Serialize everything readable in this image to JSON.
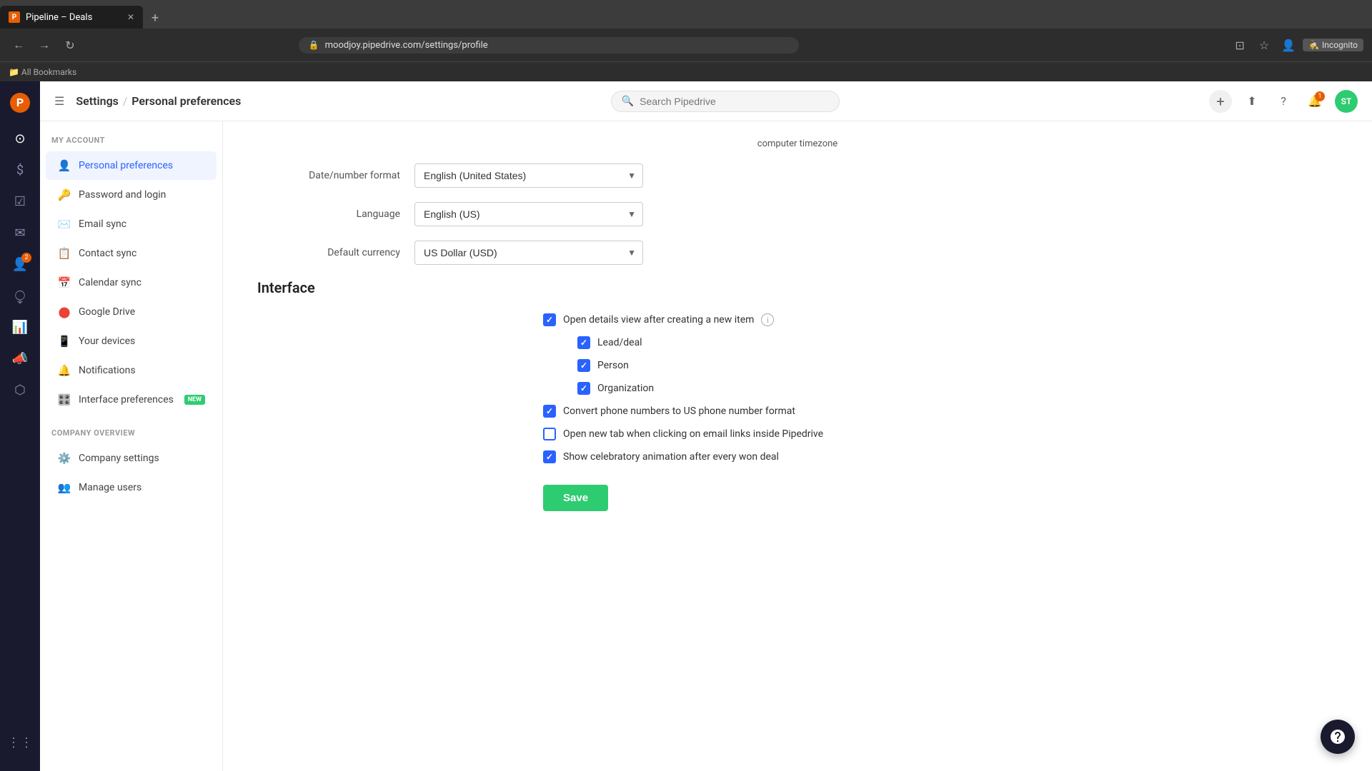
{
  "browser": {
    "tab_title": "Pipeline – Deals",
    "tab_icon": "P",
    "address": "moodjoy.pipedrive.com/settings/profile",
    "new_tab_label": "+",
    "incognito_label": "Incognito",
    "bookmarks_label": "All Bookmarks"
  },
  "header": {
    "settings_label": "Settings",
    "sep": "/",
    "page_title": "Personal preferences",
    "search_placeholder": "Search Pipedrive",
    "avatar_initials": "ST",
    "notification_count": "1"
  },
  "sidebar": {
    "my_account_label": "MY ACCOUNT",
    "company_overview_label": "COMPANY OVERVIEW",
    "items": [
      {
        "id": "personal-preferences",
        "label": "Personal preferences",
        "icon": "👤",
        "active": true
      },
      {
        "id": "password-and-login",
        "label": "Password and login",
        "icon": "🔑",
        "active": false
      },
      {
        "id": "email-sync",
        "label": "Email sync",
        "icon": "✉️",
        "active": false
      },
      {
        "id": "contact-sync",
        "label": "Contact sync",
        "icon": "📋",
        "active": false
      },
      {
        "id": "calendar-sync",
        "label": "Calendar sync",
        "icon": "📅",
        "active": false
      },
      {
        "id": "google-drive",
        "label": "Google Drive",
        "icon": "🔴",
        "active": false
      },
      {
        "id": "your-devices",
        "label": "Your devices",
        "icon": "📱",
        "active": false
      },
      {
        "id": "notifications",
        "label": "Notifications",
        "icon": "🔔",
        "active": false
      },
      {
        "id": "interface-preferences",
        "label": "Interface preferences",
        "icon": "🎛️",
        "active": false,
        "badge": "NEW"
      }
    ],
    "company_items": [
      {
        "id": "company-settings",
        "label": "Company settings",
        "icon": "⚙️",
        "active": false
      },
      {
        "id": "manage-users",
        "label": "Manage users",
        "icon": "👥",
        "active": false
      }
    ]
  },
  "content": {
    "timezone_note": "computer timezone",
    "date_format_label": "Date/number format",
    "date_format_value": "English (United States)",
    "language_label": "Language",
    "language_value": "English (US)",
    "currency_label": "Default currency",
    "currency_value": "US Dollar (USD)",
    "interface_title": "Interface",
    "checkboxes": [
      {
        "id": "open-details",
        "label": "Open details view after creating a new item",
        "checked": true,
        "info": true,
        "indent": 0
      },
      {
        "id": "lead-deal",
        "label": "Lead/deal",
        "checked": true,
        "indent": 1
      },
      {
        "id": "person",
        "label": "Person",
        "checked": true,
        "indent": 1
      },
      {
        "id": "organization",
        "label": "Organization",
        "checked": true,
        "indent": 1
      },
      {
        "id": "convert-phone",
        "label": "Convert phone numbers to US phone number format",
        "checked": true,
        "indent": 0
      },
      {
        "id": "open-new-tab",
        "label": "Open new tab when clicking on email links inside Pipedrive",
        "checked": false,
        "indent": 0
      },
      {
        "id": "celebratory",
        "label": "Show celebratory animation after every won deal",
        "checked": true,
        "indent": 0
      }
    ],
    "save_label": "Save"
  },
  "nav_rail": {
    "logo": "P",
    "icons": [
      {
        "id": "home",
        "symbol": "⊙"
      },
      {
        "id": "deals",
        "symbol": "$"
      },
      {
        "id": "tasks",
        "symbol": "☑"
      },
      {
        "id": "mail",
        "symbol": "✉"
      },
      {
        "id": "contacts",
        "symbol": "👤",
        "badge": "2"
      },
      {
        "id": "calendar",
        "symbol": "⧬"
      },
      {
        "id": "reports",
        "symbol": "📊"
      },
      {
        "id": "megaphone",
        "symbol": "📣"
      },
      {
        "id": "cube",
        "symbol": "⬡"
      },
      {
        "id": "grid",
        "symbol": "⋮⋮"
      }
    ]
  }
}
